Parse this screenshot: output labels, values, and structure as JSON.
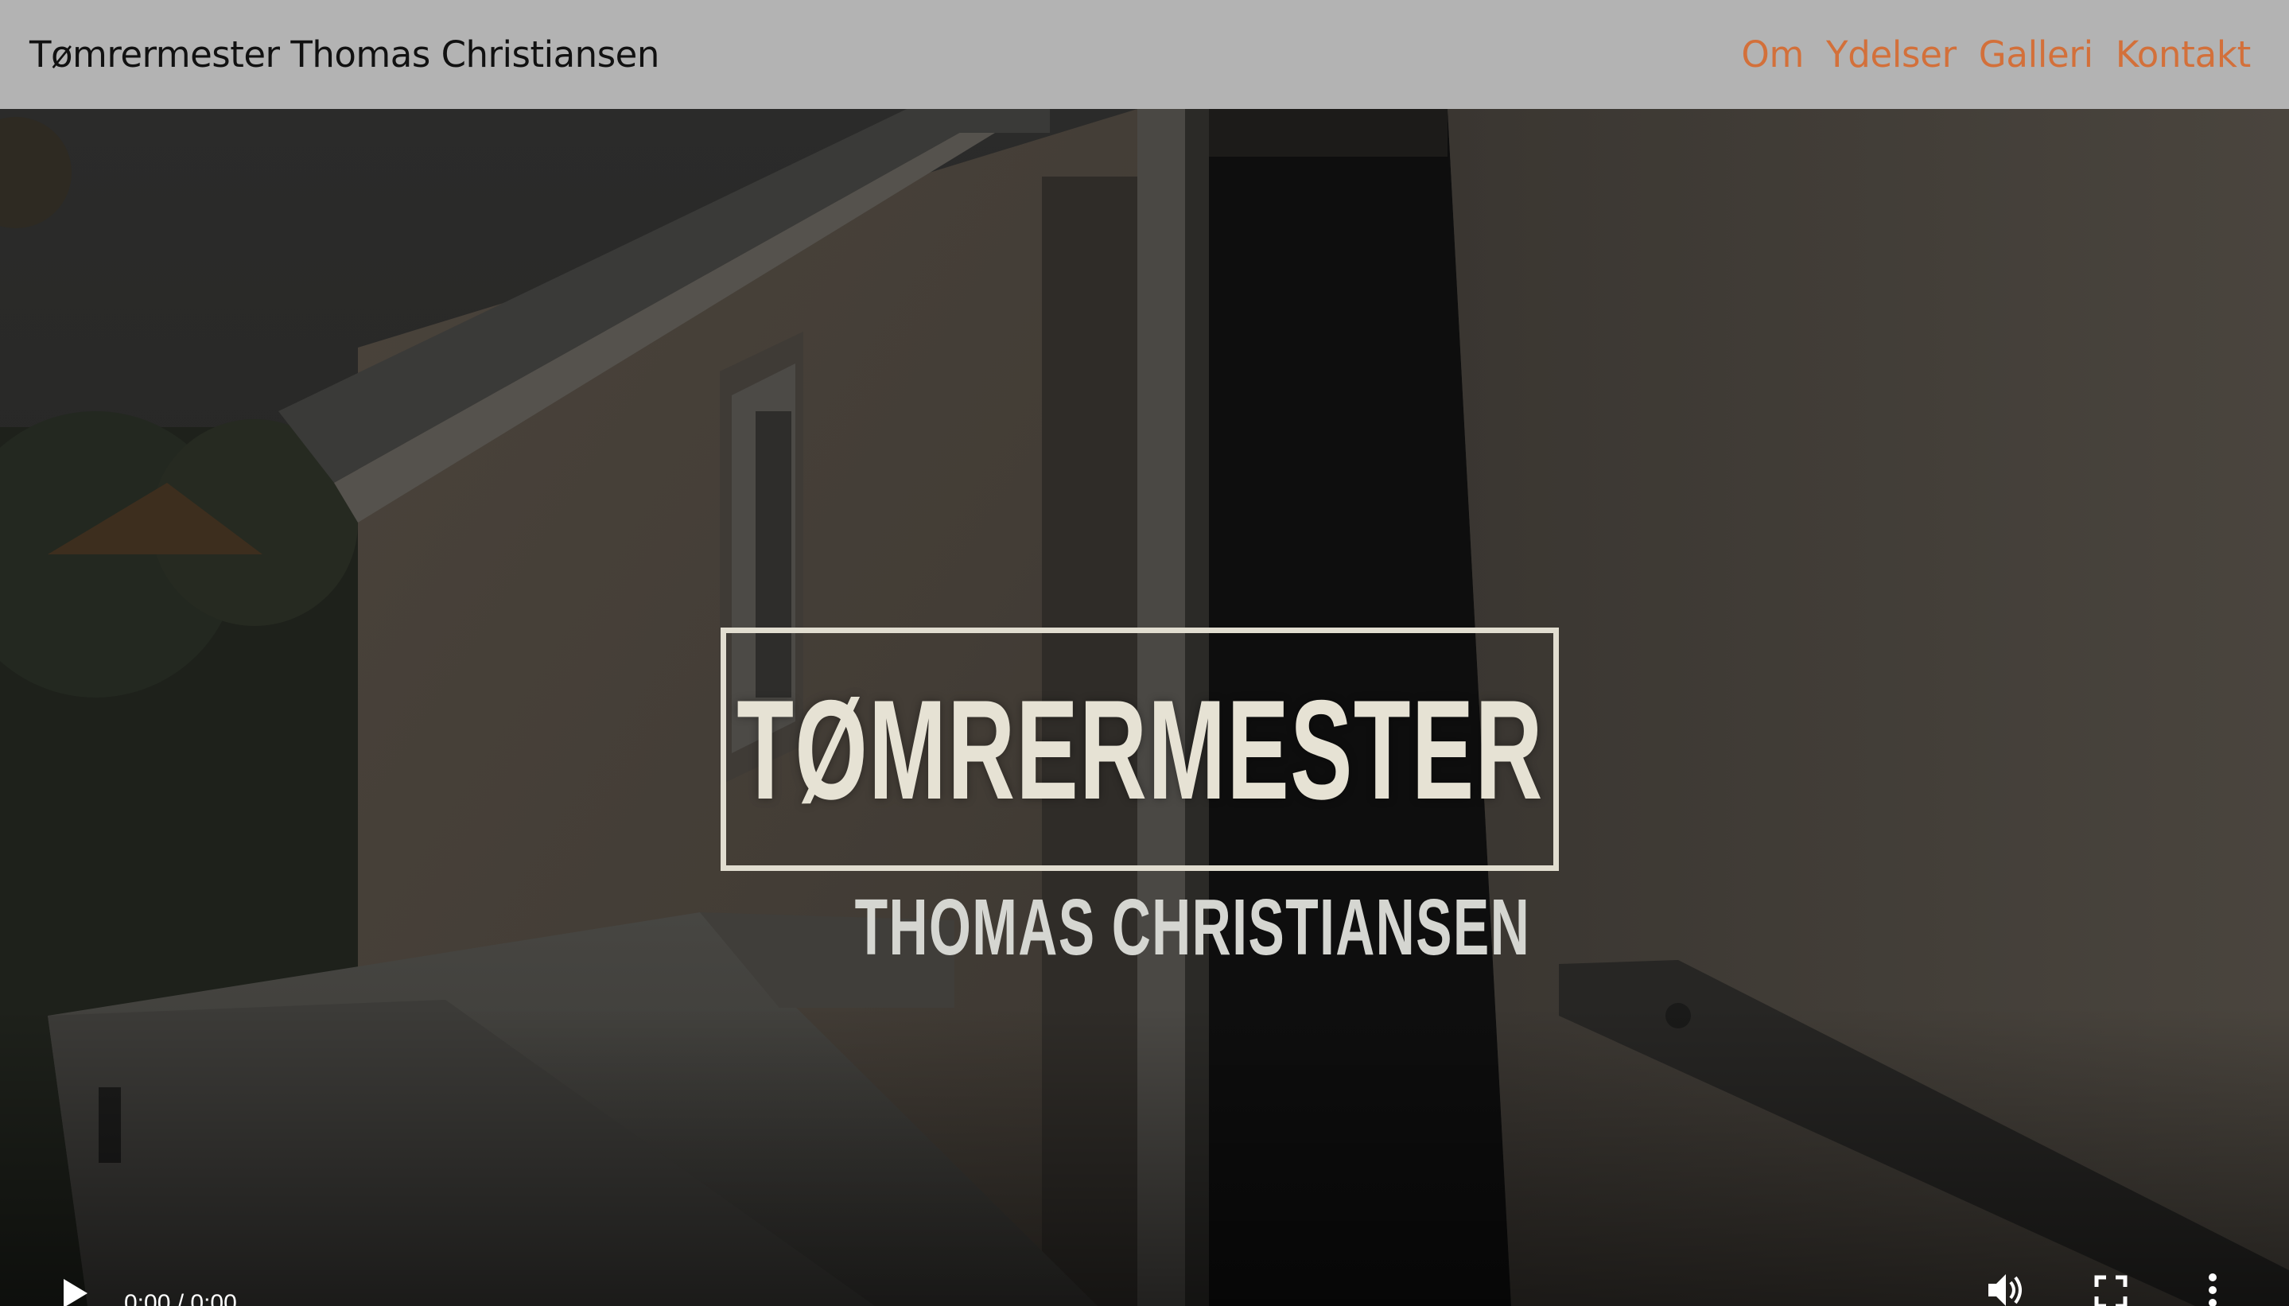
{
  "header": {
    "site_title": "Tømrermester Thomas Christiansen",
    "nav": [
      {
        "label": "Om"
      },
      {
        "label": "Ydelser"
      },
      {
        "label": "Galleri"
      },
      {
        "label": "Kontakt"
      }
    ]
  },
  "video": {
    "overlay_title": "TØMRERMESTER",
    "overlay_subtitle": "THOMAS CHRISTIANSEN",
    "time": "0:00 / 0:00",
    "controls": {
      "play_icon": "play-icon",
      "volume_icon": "volume-icon",
      "fullscreen_icon": "fullscreen-icon",
      "more_icon": "more-options-icon"
    }
  },
  "colors": {
    "header_bg": "#b3b3b3",
    "nav_link": "#d3703a",
    "title_text": "#111111"
  }
}
